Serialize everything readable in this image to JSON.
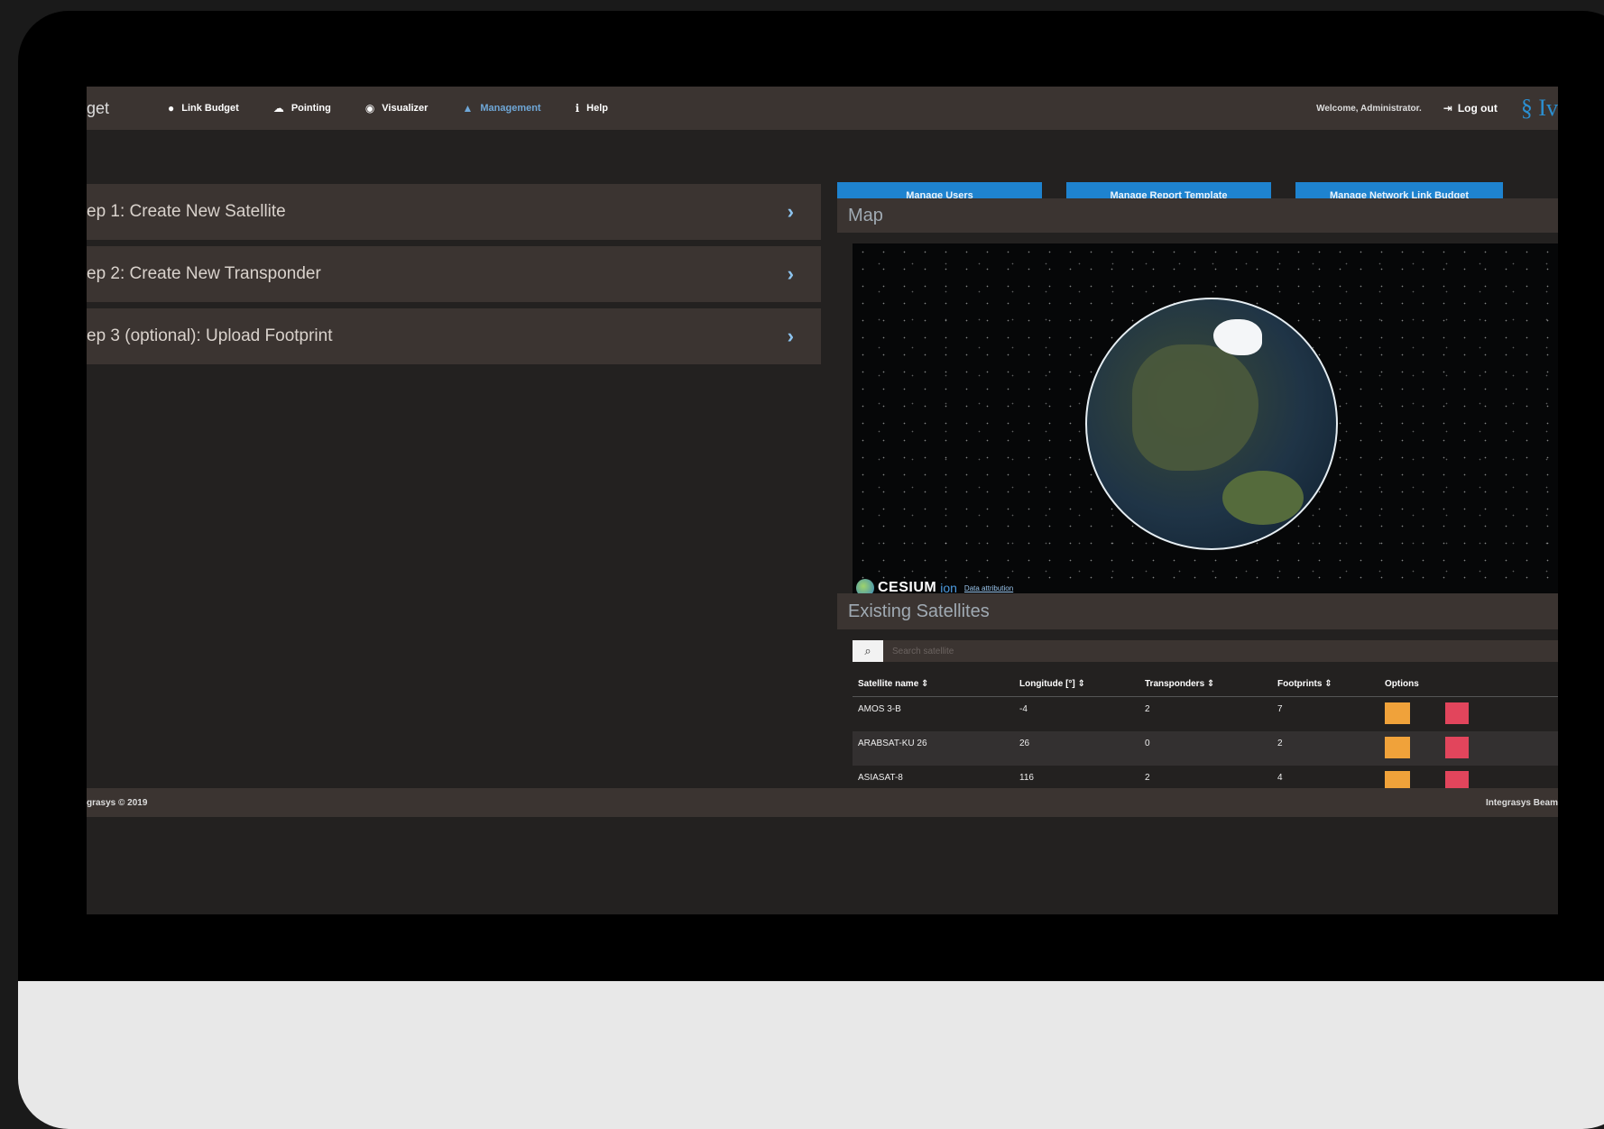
{
  "nav": {
    "brand": "get",
    "items": [
      {
        "icon": "circle-icon",
        "glyph": "●",
        "label": "Link Budget"
      },
      {
        "icon": "cloud-icon",
        "glyph": "☁",
        "label": "Pointing"
      },
      {
        "icon": "globe-icon",
        "glyph": "◉",
        "label": "Visualizer"
      },
      {
        "icon": "lock-icon",
        "glyph": "🔒",
        "label": "Management"
      },
      {
        "icon": "info-icon",
        "glyph": "ℹ",
        "label": "Help"
      }
    ],
    "welcome": "Welcome, Administrator.",
    "logout": "Log out",
    "logo": "§ Iv"
  },
  "steps": [
    {
      "label": "ep 1: Create New Satellite"
    },
    {
      "label": "ep 2: Create New Transponder"
    },
    {
      "label": "ep 3 (optional): Upload Footprint"
    }
  ],
  "buttons": {
    "manage_users": "Manage Users",
    "manage_report": "Manage Report Template",
    "manage_network": "Manage Network Link Budget"
  },
  "map": {
    "title": "Map",
    "brand_word": "CESIUM",
    "brand_ion": "ion",
    "attribution": "Data attribution"
  },
  "satellites": {
    "title": "Existing Satellites",
    "search_placeholder": "Search satellite",
    "columns": [
      "Satellite name ⇕",
      "Longitude [°] ⇕",
      "Transponders ⇕",
      "Footprints ⇕",
      "Options"
    ],
    "rows": [
      {
        "name": "AMOS 3-B",
        "longitude": "-4",
        "transponders": "2",
        "footprints": "7"
      },
      {
        "name": "ARABSAT-KU 26",
        "longitude": "26",
        "transponders": "0",
        "footprints": "2"
      },
      {
        "name": "ASIASAT-8",
        "longitude": "116",
        "transponders": "2",
        "footprints": "4"
      }
    ]
  },
  "footer": {
    "left": "grasys © 2019",
    "right": "Integrasys Beam"
  },
  "colors": {
    "nav_bg": "#3b3431",
    "accent_blue": "#1e83cf",
    "edit_orange": "#f0a23a",
    "delete_red": "#e2455c"
  }
}
